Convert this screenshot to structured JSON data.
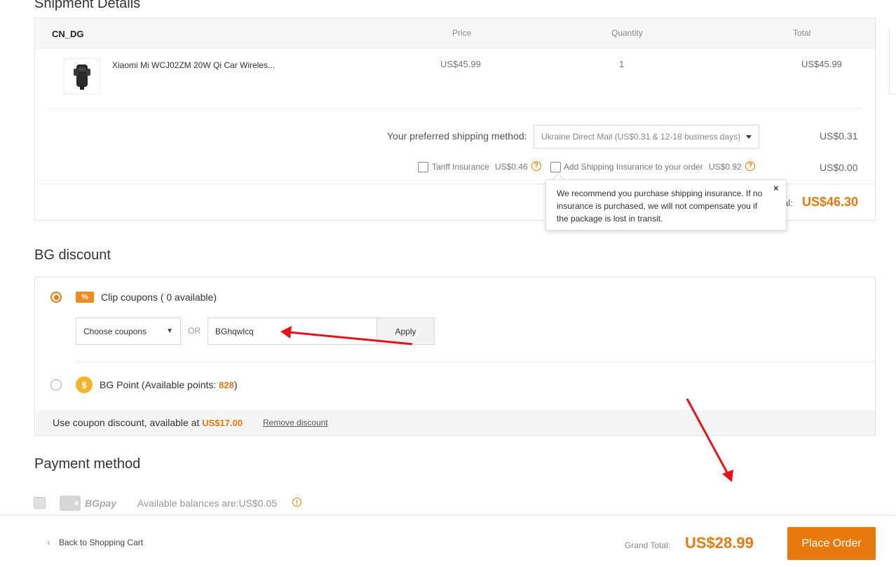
{
  "shipment": {
    "section_title": "Shipment Details",
    "store": "CN_DG",
    "columns": {
      "price": "Price",
      "quantity": "Quantity",
      "total": "Total"
    },
    "item": {
      "name": "Xiaomi Mi WCJ02ZM 20W Qi Car Wireles...",
      "price": "US$45.99",
      "quantity": "1",
      "total": "US$45.99"
    },
    "shipping_method_label": "Your preferred shipping method:",
    "shipping_method_value": "Ukraine Direct Mail (US$0.31 & 12-18 business days)",
    "shipping_fee": "US$0.31",
    "tariff_label": "Tariff Insurance",
    "tariff_price": "US$0.46",
    "insurance_label": "Add Shipping Insurance to your order",
    "insurance_price": "US$0.92",
    "insurance_fee": "US$0.00",
    "subtotal_label": "al:",
    "subtotal_value": "US$46.30",
    "tooltip_text": "We recommend you purchase shipping insurance. If no insurance is purchased, we will not compensate you if the package is lost in transit.",
    "tooltip_close": "×"
  },
  "discount": {
    "section_title": "BG discount",
    "clip_coupons_label": "Clip coupons ( 0 available)",
    "coupon_icon_text": "%",
    "choose_coupons": "Choose coupons",
    "or_label": "OR",
    "coupon_code_value": "BGhqwlcq",
    "apply_label": "Apply",
    "bg_point_label": "BG Point (Available points: ",
    "bg_point_value": "828",
    "bg_point_close": ")",
    "coin_symbol": "$",
    "use_discount_text": "Use coupon discount, available at ",
    "use_discount_value": "US$17.00",
    "remove_discount": "Remove discount"
  },
  "payment": {
    "section_title": "Payment method",
    "method_name": "BGpay",
    "balance_text": "Available balances are:US$0.05",
    "info_symbol": "!"
  },
  "footer": {
    "back_label": "Back to Shopping Cart",
    "grand_total_label": "Grand Total:",
    "grand_total_value": "US$28.99",
    "place_order_label": "Place Order"
  },
  "annotations": {
    "arrow_color": "#e5141a"
  },
  "colors": {
    "accent": "#e8790c"
  }
}
